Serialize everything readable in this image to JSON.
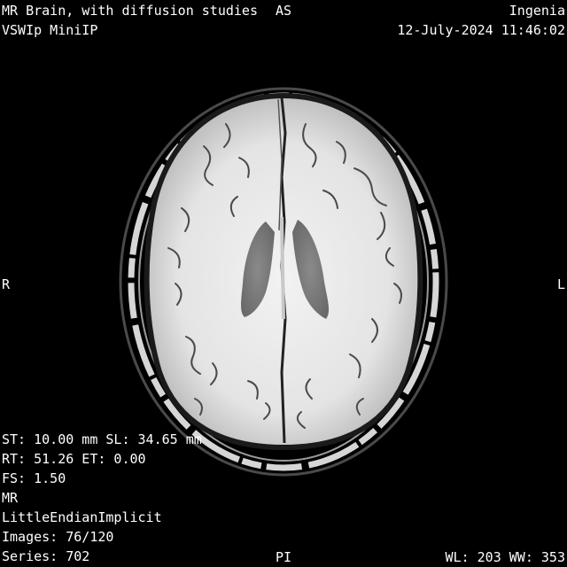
{
  "overlay": {
    "study_title": "MR Brain, with diffusion studies",
    "series_description": "VSWIp MiniIP",
    "institution": "Ingenia",
    "datetime": "12-July-2024 11:46:02",
    "orientation": {
      "top": "AS",
      "bottom": "PI",
      "left": "R",
      "right": "L"
    },
    "params": {
      "st_sl": "ST: 10.00 mm SL: 34.65 mm",
      "rt_et": "RT: 51.26 ET: 0.00",
      "fs": "FS: 1.50",
      "modality": "MR",
      "transfer_syntax": "LittleEndianImplicit",
      "images": "Images: 76/120",
      "series": "Series: 702"
    },
    "window": "WL: 203 WW: 353"
  },
  "image": {
    "modality_view": "axial-brain-swi-minip",
    "colors": {
      "background": "#000000",
      "parenchyma": "#e6e6e6",
      "ventricle": "#7d7d7d",
      "skull": "#d0d0d0",
      "vessel": "#555555",
      "text": "#ffffff"
    }
  }
}
